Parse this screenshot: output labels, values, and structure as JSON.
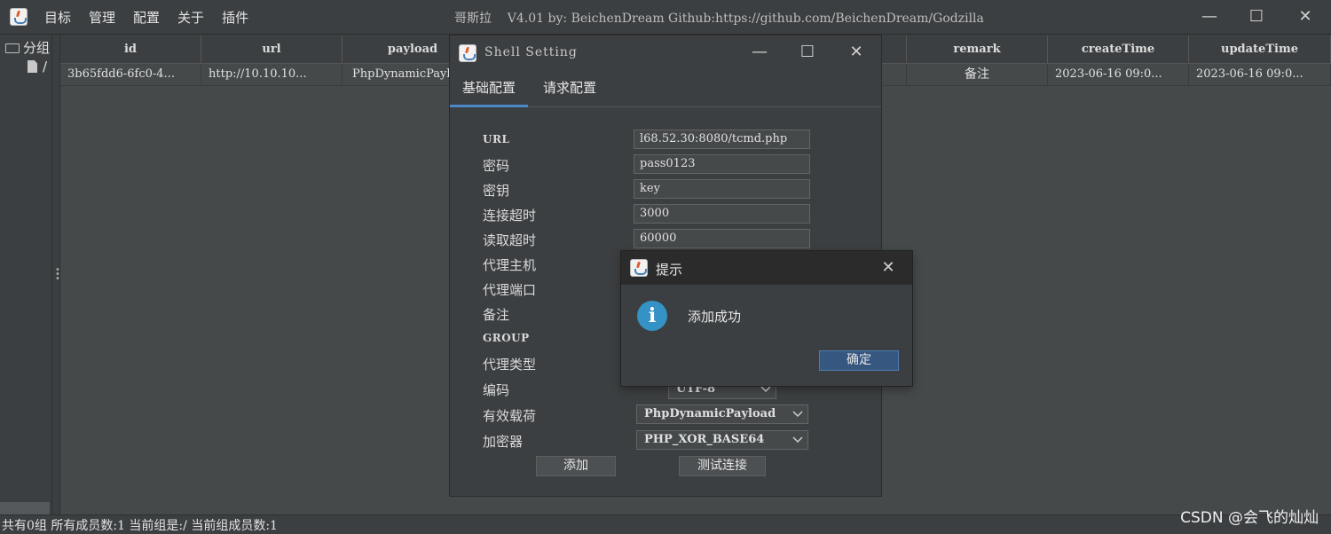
{
  "window": {
    "title": "哥斯拉    V4.01 by: BeichenDream Github:https://github.com/BeichenDream/Godzilla",
    "minimize_glyph": "—",
    "maximize_glyph": "☐",
    "close_glyph": "✕"
  },
  "menu": [
    "目标",
    "管理",
    "配置",
    "关于",
    "插件"
  ],
  "tree": {
    "root_label": "分组",
    "child_label": "/"
  },
  "table": {
    "columns": [
      "id",
      "url",
      "payload",
      "",
      "",
      "",
      "remark",
      "createTime",
      "updateTime"
    ],
    "rows": [
      [
        "3b65fdd6-6fc0-4...",
        "http://10.10.10...",
        "PhpDynamicPayl",
        "",
        "",
        "",
        "备注",
        "2023-06-16 09:0...",
        "2023-06-16 09:0..."
      ]
    ]
  },
  "status": {
    "text": "共有0组 所有成员数:1 当前组是:/ 当前组成员数:1"
  },
  "watermark": "CSDN @会飞的灿灿",
  "shell_dialog": {
    "title": "Shell Setting",
    "tabs": [
      "基础配置",
      "请求配置"
    ],
    "active_tab": 0,
    "fields": [
      {
        "label": "URL",
        "value": "l68.52.30:8080/tcmd.php"
      },
      {
        "label": "密码",
        "value": "pass0123"
      },
      {
        "label": "密钥",
        "value": "key"
      },
      {
        "label": "连接超时",
        "value": "3000"
      },
      {
        "label": "读取超时",
        "value": "60000"
      },
      {
        "label": "代理主机",
        "value": ""
      },
      {
        "label": "代理端口",
        "value": ""
      },
      {
        "label": "备注",
        "value": ""
      },
      {
        "label": "GROUP",
        "value": ""
      },
      {
        "label": "代理类型",
        "value": ""
      }
    ],
    "encoding": {
      "label": "编码",
      "value": "UTF-8"
    },
    "payload": {
      "label": "有效载荷",
      "value": "PhpDynamicPayload"
    },
    "crypto": {
      "label": "加密器",
      "value": "PHP_XOR_BASE64"
    },
    "add_button": "添加",
    "test_button": "测试连接"
  },
  "info_dialog": {
    "title": "提示",
    "icon": "info-icon",
    "icon_glyph": "i",
    "message": "添加成功",
    "ok_button": "确定"
  },
  "colors": {
    "background": "#3c3f41",
    "table_bg": "#45494a",
    "accent": "#4a88c7",
    "primary_button": "#365880",
    "info_icon": "#3592c4"
  }
}
